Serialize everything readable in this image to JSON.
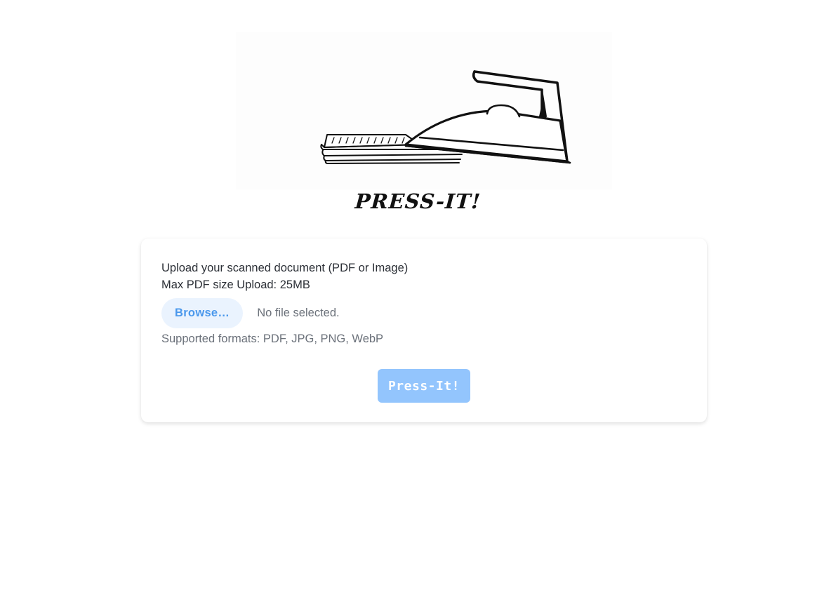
{
  "brand": {
    "title": "PRESS-IT!"
  },
  "upload": {
    "instruction": "Upload your scanned document (PDF or Image)",
    "max_size": "Max PDF size Upload: 25MB",
    "browse_label": "Browse…",
    "file_status": "No file selected.",
    "formats": "Supported formats: PDF, JPG, PNG, WebP",
    "submit_label": "Press-It!",
    "submit_disabled": true
  },
  "icons": {
    "hero": "clothes-iron-pressing-documents-illustration"
  },
  "colors": {
    "accent": "#4a98ec",
    "browse_bg": "#eaf3fe",
    "submit_bg_disabled": "#93c5fd",
    "text_primary": "#2b2f36",
    "text_muted": "#6b717a"
  }
}
